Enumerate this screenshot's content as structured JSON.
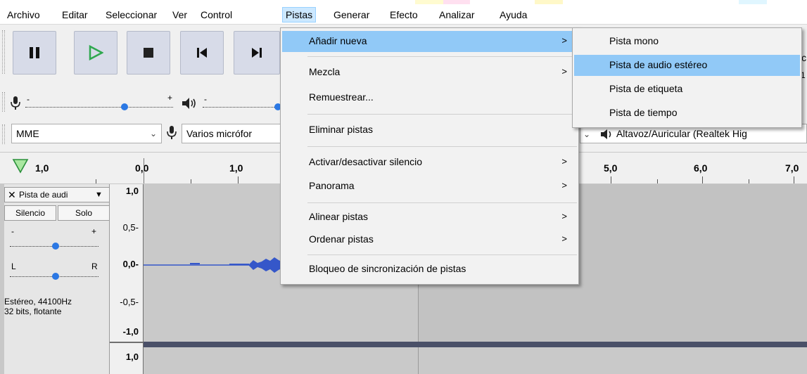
{
  "menubar": {
    "items": [
      {
        "label": "Archivo"
      },
      {
        "label": "Editar"
      },
      {
        "label": "Seleccionar"
      },
      {
        "label": "Ver"
      },
      {
        "label": "Control"
      },
      {
        "label": "Pistas"
      },
      {
        "label": "Generar"
      },
      {
        "label": "Efecto"
      },
      {
        "label": "Analizar"
      },
      {
        "label": "Ayuda"
      }
    ],
    "active": "Pistas"
  },
  "transport": {
    "pause_icon": "pause-icon",
    "play_icon": "play-icon",
    "stop_icon": "stop-icon",
    "skip_start_icon": "skip-to-start-icon",
    "skip_end_icon": "skip-to-end-icon"
  },
  "meters": {
    "record_minus": "-",
    "record_plus": "+",
    "play_minus": "-"
  },
  "devices": {
    "host": "MME",
    "input": "Varios micrófor",
    "output": "Altavoz/Auricular (Realtek Hig"
  },
  "ruler": {
    "labels": [
      "1,0",
      "0,0",
      "1,0",
      "5,0",
      "6,0",
      "7,0"
    ]
  },
  "track": {
    "name": "Pista de audi",
    "mute_label": "Silencio",
    "solo_label": "Solo",
    "gain_minus": "-",
    "gain_plus": "+",
    "pan_left": "L",
    "pan_right": "R",
    "info_line1": "Estéreo, 44100Hz",
    "info_line2": "32 bits, flotante",
    "scale": [
      "1,0",
      "0,5-",
      "0,0-",
      "-0,5-",
      "-1,0",
      "1,0"
    ]
  },
  "pistas_menu": {
    "items": [
      {
        "label": "Añadir nueva",
        "has_submenu": true
      },
      {
        "label": "Mezcla",
        "has_submenu": true
      },
      {
        "label": "Remuestrear...",
        "has_submenu": false
      },
      {
        "label": "Eliminar pistas",
        "has_submenu": false
      },
      {
        "label": "Activar/desactivar silencio",
        "has_submenu": true
      },
      {
        "label": "Panorama",
        "has_submenu": true
      },
      {
        "label": "Alinear pistas",
        "has_submenu": true
      },
      {
        "label": "Ordenar pistas",
        "has_submenu": true
      },
      {
        "label": "Bloqueo de sincronización de pistas",
        "has_submenu": false
      }
    ],
    "submenu_arrow": ">"
  },
  "add_new_submenu": {
    "items": [
      {
        "label": "Pista mono"
      },
      {
        "label": "Pista de audio estéreo"
      },
      {
        "label": "Pista de etiqueta"
      },
      {
        "label": "Pista de tiempo"
      }
    ],
    "highlighted": "Pista de audio estéreo"
  },
  "partial_text": {
    "right_edge_top": "ici",
    "right_edge_mid": "1"
  },
  "colors": {
    "menu_highlight": "#91c9f7",
    "transport_bg": "#d7dbe8",
    "play_green": "#2fa84f",
    "slider_blue": "#2b78e4",
    "wave_blue": "#3557c9"
  }
}
